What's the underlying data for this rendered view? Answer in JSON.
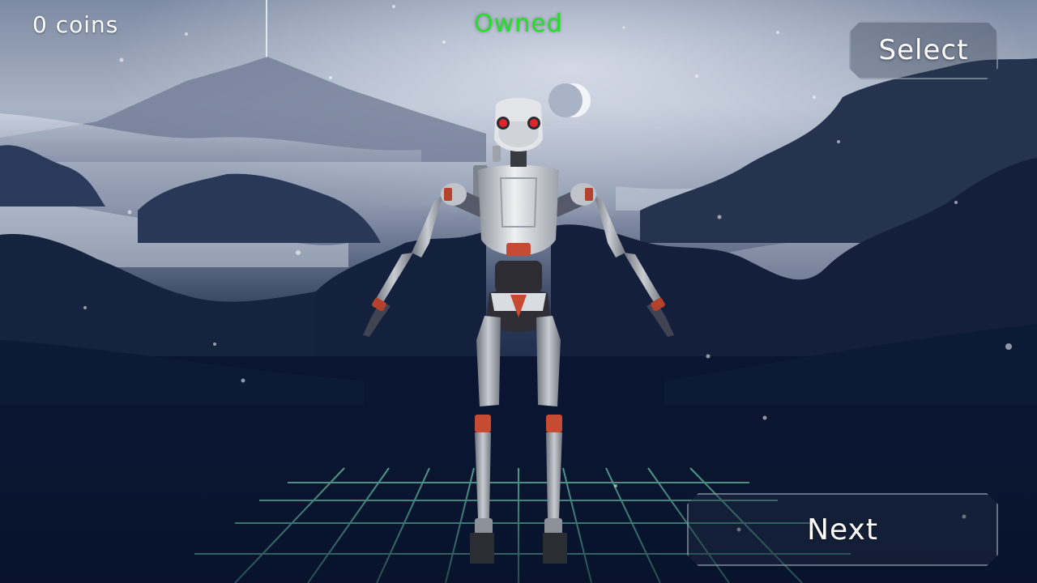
{
  "hud": {
    "coins_label": "0 coins",
    "status_label": "Owned"
  },
  "buttons": {
    "select_label": "Select",
    "next_label": "Next"
  },
  "colors": {
    "status_owned": "#22e02a",
    "button_text": "#ffffff",
    "grid_line": "#6fd4b4"
  }
}
